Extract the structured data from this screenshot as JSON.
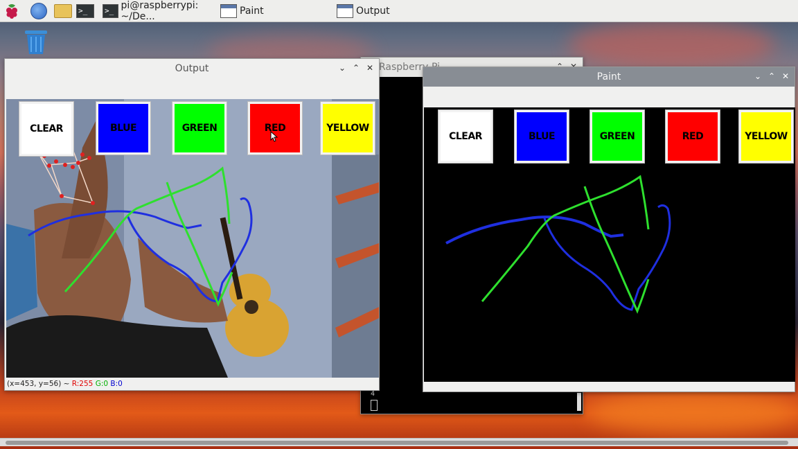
{
  "taskbar": {
    "tasks": [
      {
        "label": "pi@raspberrypi: ~/De..."
      },
      {
        "label": "Paint"
      },
      {
        "label": "Output"
      }
    ]
  },
  "windows": {
    "terminal": {
      "title": "Raspberry-Pi",
      "cursor_text": "4"
    },
    "output": {
      "title": "Output",
      "buttons": [
        "CLEAR",
        "BLUE",
        "GREEN",
        "RED",
        "YELLOW"
      ],
      "status": {
        "coords": "(x=453, y=56) ~ ",
        "r": "R:255",
        "g": "G:0",
        "b": "B:0"
      }
    },
    "paint": {
      "title": "Paint",
      "buttons": [
        "CLEAR",
        "BLUE",
        "GREEN",
        "RED",
        "YELLOW"
      ]
    }
  },
  "colors": {
    "clear": "#ffffff",
    "blue": "#0000ff",
    "green": "#00ff00",
    "red": "#ff0000",
    "yellow": "#ffff00",
    "stroke_blue": "#1f2fe0",
    "stroke_green": "#2ee02e"
  },
  "icons": [
    "raspberry-icon",
    "globe-icon",
    "folder-icon",
    "terminal-icon",
    "trash-icon",
    "window-icon",
    "minimize-icon",
    "maximize-icon",
    "close-icon"
  ]
}
